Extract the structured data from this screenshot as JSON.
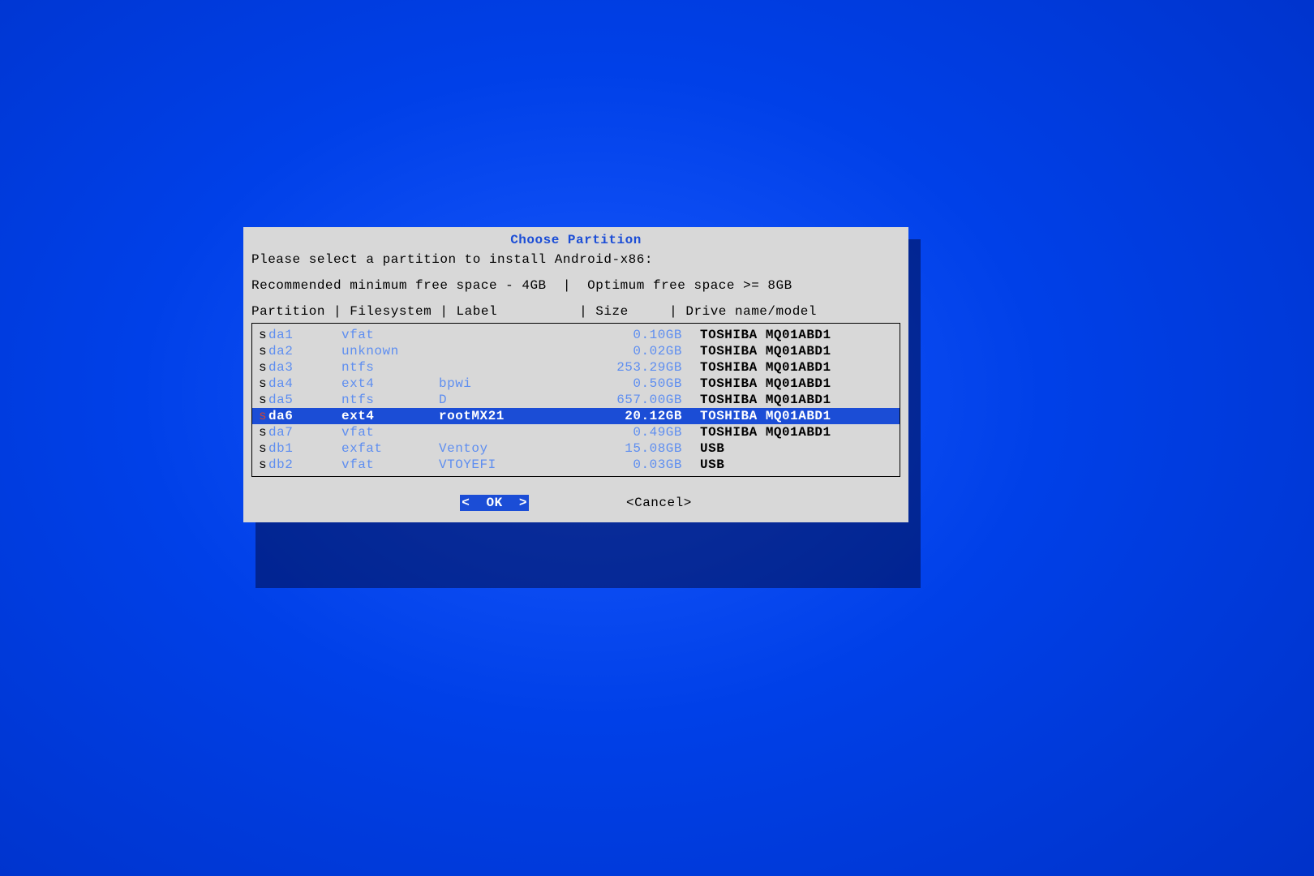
{
  "dialog": {
    "title": "Choose Partition",
    "prompt": "Please select a partition to install Android-x86:",
    "recommendation": "Recommended minimum free space - 4GB  |  Optimum free space >= 8GB",
    "headers": "Partition | Filesystem | Label          | Size     | Drive name/model"
  },
  "partitions": [
    {
      "lead": "s",
      "part": "da1",
      "fs": "vfat",
      "label": "",
      "size": "0.10GB",
      "drive": "TOSHIBA MQ01ABD1",
      "selected": false
    },
    {
      "lead": "s",
      "part": "da2",
      "fs": "unknown",
      "label": "",
      "size": "0.02GB",
      "drive": "TOSHIBA MQ01ABD1",
      "selected": false
    },
    {
      "lead": "s",
      "part": "da3",
      "fs": "ntfs",
      "label": "",
      "size": "253.29GB",
      "drive": "TOSHIBA MQ01ABD1",
      "selected": false
    },
    {
      "lead": "s",
      "part": "da4",
      "fs": "ext4",
      "label": "bpwi",
      "size": "0.50GB",
      "drive": "TOSHIBA MQ01ABD1",
      "selected": false
    },
    {
      "lead": "s",
      "part": "da5",
      "fs": "ntfs",
      "label": "D",
      "size": "657.00GB",
      "drive": "TOSHIBA MQ01ABD1",
      "selected": false
    },
    {
      "lead": "s",
      "part": "da6",
      "fs": "ext4",
      "label": "rootMX21",
      "size": "20.12GB",
      "drive": "TOSHIBA MQ01ABD1",
      "selected": true
    },
    {
      "lead": "s",
      "part": "da7",
      "fs": "vfat",
      "label": "",
      "size": "0.49GB",
      "drive": "TOSHIBA MQ01ABD1",
      "selected": false
    },
    {
      "lead": "s",
      "part": "db1",
      "fs": "exfat",
      "label": "Ventoy",
      "size": "15.08GB",
      "drive": "USB",
      "selected": false
    },
    {
      "lead": "s",
      "part": "db2",
      "fs": "vfat",
      "label": "VTOYEFI",
      "size": "0.03GB",
      "drive": "USB",
      "selected": false
    }
  ],
  "buttons": {
    "ok": "<  OK  >",
    "cancel": "<Cancel>"
  }
}
